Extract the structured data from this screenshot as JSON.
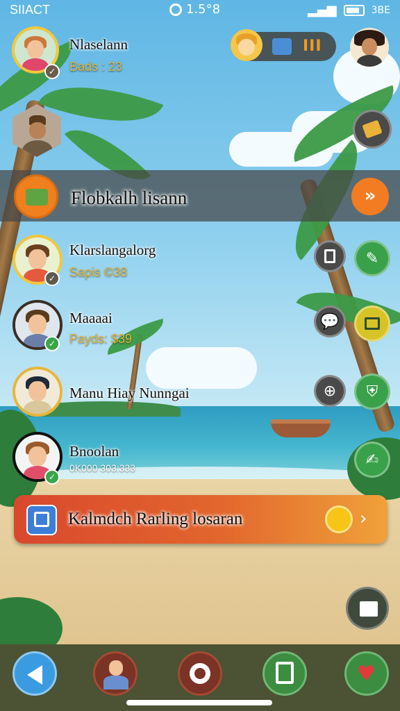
{
  "status_bar": {
    "left": "SIIACT",
    "time": "1.5°8",
    "battery": "3ВЕ"
  },
  "top_profile": {
    "name": "Nlaselann",
    "score": "Bads : 23"
  },
  "hud": {
    "level_value": "III"
  },
  "banner": {
    "title": "Flobkalh lisann",
    "action_icon": "double-chevron"
  },
  "players": [
    {
      "name": "Klarslangalorg",
      "score": "Sapis ©38"
    },
    {
      "name": "Maaaai",
      "score": "Payds: $39"
    },
    {
      "name": "Manu Hiay Nunngai",
      "score": ""
    },
    {
      "name": "Bnoolan",
      "score": "0K000 303:333"
    }
  ],
  "ranking_bar": {
    "label": "Kalmdch Rarling losaran",
    "arrow": "›"
  },
  "icons": {
    "side": [
      "notebook-icon",
      "trash-icon",
      "chat-icon",
      "compass-icon",
      "pencil-icon",
      "board-icon",
      "shield-icon",
      "wrench-icon"
    ],
    "nav": [
      "back-icon",
      "profile-icon",
      "gear-icon",
      "note-icon",
      "heart-icon"
    ]
  },
  "colors": {
    "accent_orange": "#f07f1e",
    "accent_green": "#39a14a",
    "nav_bg": "#4c5234",
    "score_gold": "#e2b53d"
  }
}
